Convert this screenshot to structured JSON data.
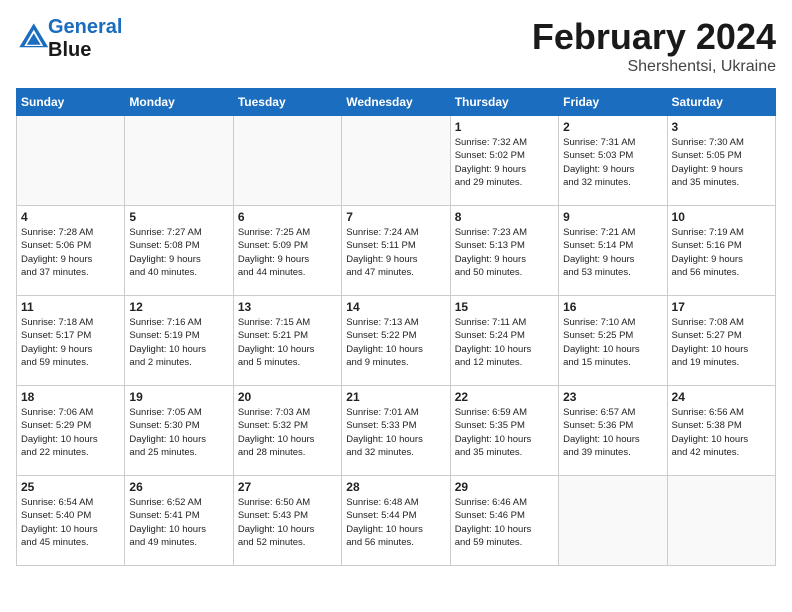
{
  "header": {
    "logo_line1": "General",
    "logo_line2": "Blue",
    "month": "February 2024",
    "location": "Shershentsi, Ukraine"
  },
  "weekdays": [
    "Sunday",
    "Monday",
    "Tuesday",
    "Wednesday",
    "Thursday",
    "Friday",
    "Saturday"
  ],
  "weeks": [
    [
      {
        "day": "",
        "info": ""
      },
      {
        "day": "",
        "info": ""
      },
      {
        "day": "",
        "info": ""
      },
      {
        "day": "",
        "info": ""
      },
      {
        "day": "1",
        "info": "Sunrise: 7:32 AM\nSunset: 5:02 PM\nDaylight: 9 hours\nand 29 minutes."
      },
      {
        "day": "2",
        "info": "Sunrise: 7:31 AM\nSunset: 5:03 PM\nDaylight: 9 hours\nand 32 minutes."
      },
      {
        "day": "3",
        "info": "Sunrise: 7:30 AM\nSunset: 5:05 PM\nDaylight: 9 hours\nand 35 minutes."
      }
    ],
    [
      {
        "day": "4",
        "info": "Sunrise: 7:28 AM\nSunset: 5:06 PM\nDaylight: 9 hours\nand 37 minutes."
      },
      {
        "day": "5",
        "info": "Sunrise: 7:27 AM\nSunset: 5:08 PM\nDaylight: 9 hours\nand 40 minutes."
      },
      {
        "day": "6",
        "info": "Sunrise: 7:25 AM\nSunset: 5:09 PM\nDaylight: 9 hours\nand 44 minutes."
      },
      {
        "day": "7",
        "info": "Sunrise: 7:24 AM\nSunset: 5:11 PM\nDaylight: 9 hours\nand 47 minutes."
      },
      {
        "day": "8",
        "info": "Sunrise: 7:23 AM\nSunset: 5:13 PM\nDaylight: 9 hours\nand 50 minutes."
      },
      {
        "day": "9",
        "info": "Sunrise: 7:21 AM\nSunset: 5:14 PM\nDaylight: 9 hours\nand 53 minutes."
      },
      {
        "day": "10",
        "info": "Sunrise: 7:19 AM\nSunset: 5:16 PM\nDaylight: 9 hours\nand 56 minutes."
      }
    ],
    [
      {
        "day": "11",
        "info": "Sunrise: 7:18 AM\nSunset: 5:17 PM\nDaylight: 9 hours\nand 59 minutes."
      },
      {
        "day": "12",
        "info": "Sunrise: 7:16 AM\nSunset: 5:19 PM\nDaylight: 10 hours\nand 2 minutes."
      },
      {
        "day": "13",
        "info": "Sunrise: 7:15 AM\nSunset: 5:21 PM\nDaylight: 10 hours\nand 5 minutes."
      },
      {
        "day": "14",
        "info": "Sunrise: 7:13 AM\nSunset: 5:22 PM\nDaylight: 10 hours\nand 9 minutes."
      },
      {
        "day": "15",
        "info": "Sunrise: 7:11 AM\nSunset: 5:24 PM\nDaylight: 10 hours\nand 12 minutes."
      },
      {
        "day": "16",
        "info": "Sunrise: 7:10 AM\nSunset: 5:25 PM\nDaylight: 10 hours\nand 15 minutes."
      },
      {
        "day": "17",
        "info": "Sunrise: 7:08 AM\nSunset: 5:27 PM\nDaylight: 10 hours\nand 19 minutes."
      }
    ],
    [
      {
        "day": "18",
        "info": "Sunrise: 7:06 AM\nSunset: 5:29 PM\nDaylight: 10 hours\nand 22 minutes."
      },
      {
        "day": "19",
        "info": "Sunrise: 7:05 AM\nSunset: 5:30 PM\nDaylight: 10 hours\nand 25 minutes."
      },
      {
        "day": "20",
        "info": "Sunrise: 7:03 AM\nSunset: 5:32 PM\nDaylight: 10 hours\nand 28 minutes."
      },
      {
        "day": "21",
        "info": "Sunrise: 7:01 AM\nSunset: 5:33 PM\nDaylight: 10 hours\nand 32 minutes."
      },
      {
        "day": "22",
        "info": "Sunrise: 6:59 AM\nSunset: 5:35 PM\nDaylight: 10 hours\nand 35 minutes."
      },
      {
        "day": "23",
        "info": "Sunrise: 6:57 AM\nSunset: 5:36 PM\nDaylight: 10 hours\nand 39 minutes."
      },
      {
        "day": "24",
        "info": "Sunrise: 6:56 AM\nSunset: 5:38 PM\nDaylight: 10 hours\nand 42 minutes."
      }
    ],
    [
      {
        "day": "25",
        "info": "Sunrise: 6:54 AM\nSunset: 5:40 PM\nDaylight: 10 hours\nand 45 minutes."
      },
      {
        "day": "26",
        "info": "Sunrise: 6:52 AM\nSunset: 5:41 PM\nDaylight: 10 hours\nand 49 minutes."
      },
      {
        "day": "27",
        "info": "Sunrise: 6:50 AM\nSunset: 5:43 PM\nDaylight: 10 hours\nand 52 minutes."
      },
      {
        "day": "28",
        "info": "Sunrise: 6:48 AM\nSunset: 5:44 PM\nDaylight: 10 hours\nand 56 minutes."
      },
      {
        "day": "29",
        "info": "Sunrise: 6:46 AM\nSunset: 5:46 PM\nDaylight: 10 hours\nand 59 minutes."
      },
      {
        "day": "",
        "info": ""
      },
      {
        "day": "",
        "info": ""
      }
    ]
  ]
}
